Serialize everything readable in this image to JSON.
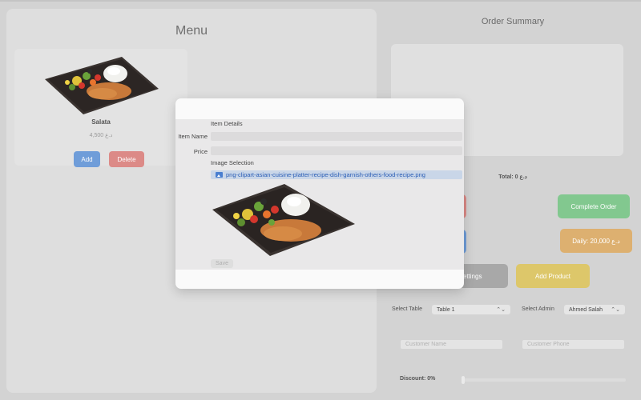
{
  "menu": {
    "title": "Menu",
    "items": [
      {
        "name": "Salata",
        "price": "4,500 د.ع",
        "add_label": "Add",
        "delete_label": "Delete"
      }
    ]
  },
  "order": {
    "title": "Order Summary",
    "total": "Total: 0 د.ع",
    "complete_label": "Complete Order",
    "daily_label": "Daily: 20,000 د.ع",
    "settings_label": "Settings",
    "add_product_label": "Add Product",
    "select_table_label": "Select Table",
    "table_value": "Table 1",
    "select_admin_label": "Select Admin",
    "admin_value": "Ahmed Salah",
    "customer_name_placeholder": "Customer Name",
    "customer_phone_placeholder": "Customer Phone",
    "discount_label": "Discount: 0%",
    "discount_value": 0
  },
  "modal": {
    "section_details": "Item Details",
    "item_name_label": "Item Name",
    "item_name_value": "",
    "price_label": "Price",
    "price_value": "",
    "section_image": "Image Selection",
    "file_name": "png-clipart-asian-cuisine-platter-recipe-dish-garnish-others-food-recipe.png",
    "save_label": "Save"
  },
  "icons": {
    "select_arrows": "⌃⌄",
    "file": "image-file-icon"
  },
  "colors": {
    "add": "#6f9dd9",
    "delete": "#dc8a87",
    "complete": "#82c88f",
    "daily": "#ddb070",
    "settings": "#a8a8a8",
    "add_product": "#ddc76a",
    "file_link": "#2a5db5"
  }
}
